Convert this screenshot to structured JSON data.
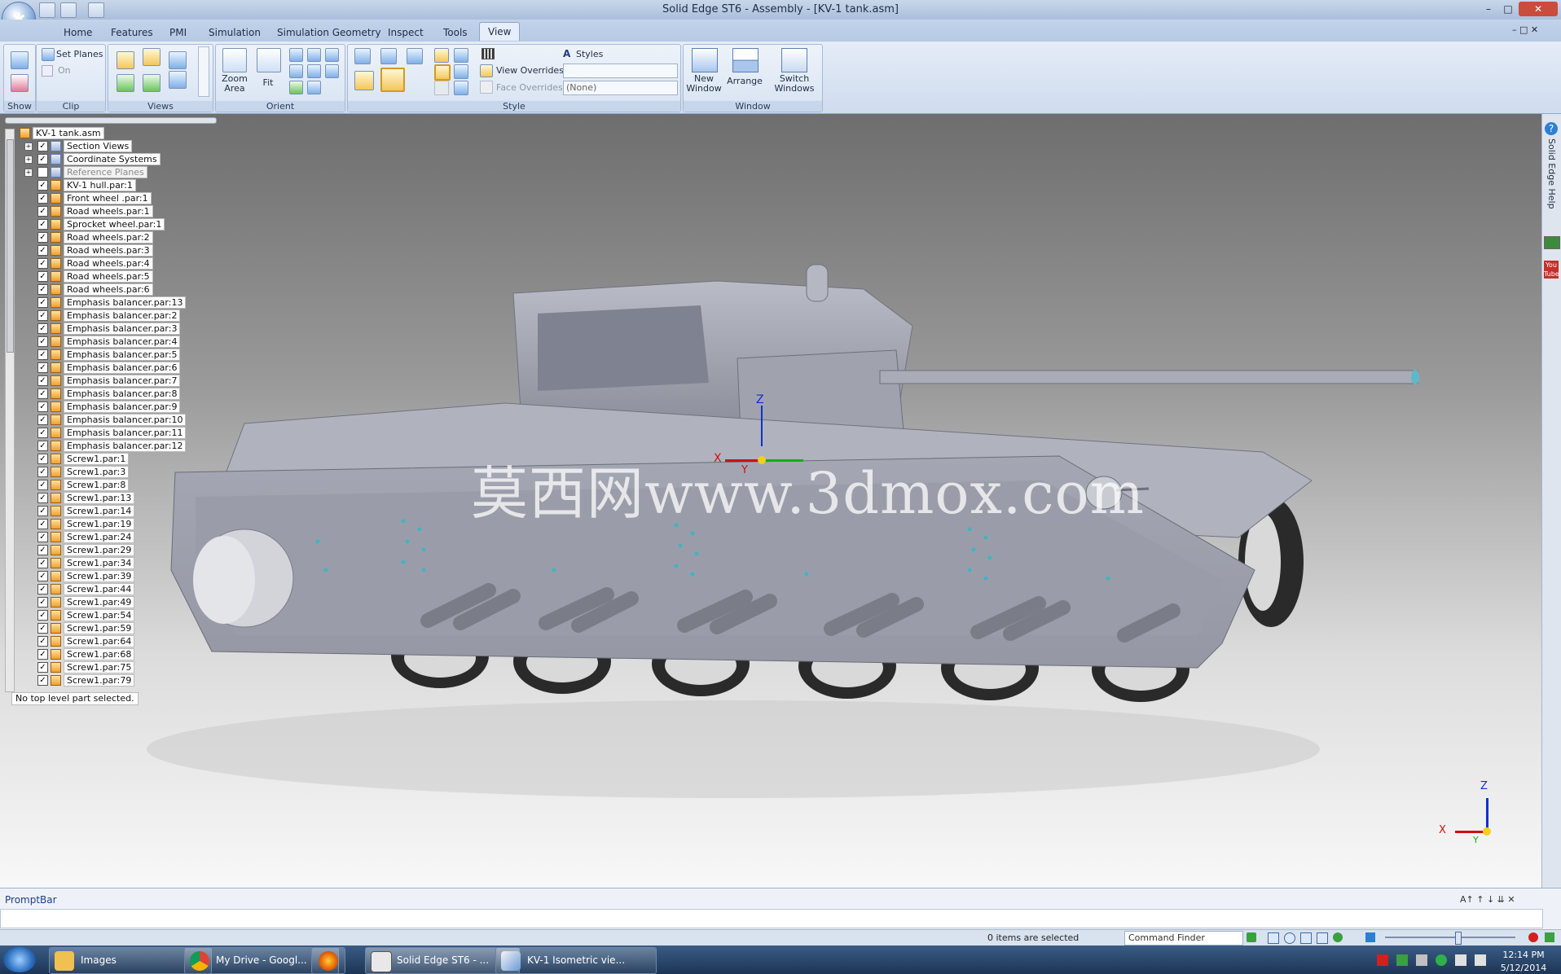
{
  "window": {
    "title": "Solid Edge ST6 - Assembly - [KV-1 tank.asm]"
  },
  "tabs": [
    {
      "label": "Home"
    },
    {
      "label": "Features"
    },
    {
      "label": "PMI"
    },
    {
      "label": "Simulation"
    },
    {
      "label": "Simulation Geometry"
    },
    {
      "label": "Inspect"
    },
    {
      "label": "Tools"
    },
    {
      "label": "View"
    }
  ],
  "ribbon": {
    "groups": {
      "show": "Show",
      "clip": "Clip",
      "views": "Views",
      "orient": "Orient",
      "style": "Style",
      "window": "Window"
    },
    "set_planes": "Set Planes",
    "on": "On",
    "zoom_area": "Zoom\nArea",
    "fit": "Fit",
    "styles": "Styles",
    "view_overrides": "View Overrides",
    "face_overrides": "Face Overrides",
    "view_overrides_value": "",
    "face_overrides_value": "(None)",
    "new_window": "New\nWindow",
    "arrange": "Arrange",
    "switch_windows": "Switch\nWindows"
  },
  "tree": {
    "root": "KV-1 tank.asm",
    "items": [
      {
        "label": "Section Views",
        "checked": true,
        "expand": true
      },
      {
        "label": "Coordinate Systems",
        "checked": true,
        "expand": true
      },
      {
        "label": "Reference Planes",
        "checked": false,
        "expand": true,
        "dim": true
      },
      {
        "label": "KV-1 hull.par:1",
        "checked": true
      },
      {
        "label": "Front wheel .par:1",
        "checked": true
      },
      {
        "label": "Road wheels.par:1",
        "checked": true
      },
      {
        "label": "Sprocket wheel.par:1",
        "checked": true
      },
      {
        "label": "Road wheels.par:2",
        "checked": true
      },
      {
        "label": "Road wheels.par:3",
        "checked": true
      },
      {
        "label": "Road wheels.par:4",
        "checked": true
      },
      {
        "label": "Road wheels.par:5",
        "checked": true
      },
      {
        "label": "Road wheels.par:6",
        "checked": true
      },
      {
        "label": "Emphasis balancer.par:13",
        "checked": true
      },
      {
        "label": "Emphasis balancer.par:2",
        "checked": true
      },
      {
        "label": "Emphasis balancer.par:3",
        "checked": true
      },
      {
        "label": "Emphasis balancer.par:4",
        "checked": true
      },
      {
        "label": "Emphasis balancer.par:5",
        "checked": true
      },
      {
        "label": "Emphasis balancer.par:6",
        "checked": true
      },
      {
        "label": "Emphasis balancer.par:7",
        "checked": true
      },
      {
        "label": "Emphasis balancer.par:8",
        "checked": true
      },
      {
        "label": "Emphasis balancer.par:9",
        "checked": true
      },
      {
        "label": "Emphasis balancer.par:10",
        "checked": true
      },
      {
        "label": "Emphasis balancer.par:11",
        "checked": true
      },
      {
        "label": "Emphasis balancer.par:12",
        "checked": true
      },
      {
        "label": "Screw1.par:1",
        "checked": true
      },
      {
        "label": "Screw1.par:3",
        "checked": true
      },
      {
        "label": "Screw1.par:8",
        "checked": true
      },
      {
        "label": "Screw1.par:13",
        "checked": true
      },
      {
        "label": "Screw1.par:14",
        "checked": true
      },
      {
        "label": "Screw1.par:19",
        "checked": true
      },
      {
        "label": "Screw1.par:24",
        "checked": true
      },
      {
        "label": "Screw1.par:29",
        "checked": true
      },
      {
        "label": "Screw1.par:34",
        "checked": true
      },
      {
        "label": "Screw1.par:39",
        "checked": true
      },
      {
        "label": "Screw1.par:44",
        "checked": true
      },
      {
        "label": "Screw1.par:49",
        "checked": true
      },
      {
        "label": "Screw1.par:54",
        "checked": true
      },
      {
        "label": "Screw1.par:59",
        "checked": true
      },
      {
        "label": "Screw1.par:64",
        "checked": true
      },
      {
        "label": "Screw1.par:68",
        "checked": true
      },
      {
        "label": "Screw1.par:75",
        "checked": true
      },
      {
        "label": "Screw1.par:79",
        "checked": true
      }
    ],
    "status": "No top level part selected."
  },
  "viewport": {
    "watermark": "莫西网www.3dmox.com",
    "axis_z": "Z",
    "axis_x": "X",
    "axis_y": "Y",
    "triad_z": "Z",
    "triad_x": "X",
    "triad_y": "Y"
  },
  "sidebar": {
    "help_label": "Solid Edge Help"
  },
  "promptbar": {
    "label": "PromptBar"
  },
  "status": {
    "selected": "0 items are selected",
    "command_finder": "Command Finder"
  },
  "taskbar": {
    "items": [
      {
        "label": "Images"
      },
      {
        "label": "My Drive - Googl..."
      },
      {
        "label": ""
      },
      {
        "label": "Solid Edge ST6 - ..."
      },
      {
        "label": "KV-1 Isometric vie..."
      }
    ],
    "time": "12:14 PM",
    "date": "5/12/2014"
  },
  "colors": {
    "accent": "#1d3e84",
    "viewport_top": "#6e6e6e",
    "tank": "#9da0ad",
    "axis_x": "#d01010",
    "axis_y": "#10b010",
    "axis_z": "#1030d0"
  }
}
